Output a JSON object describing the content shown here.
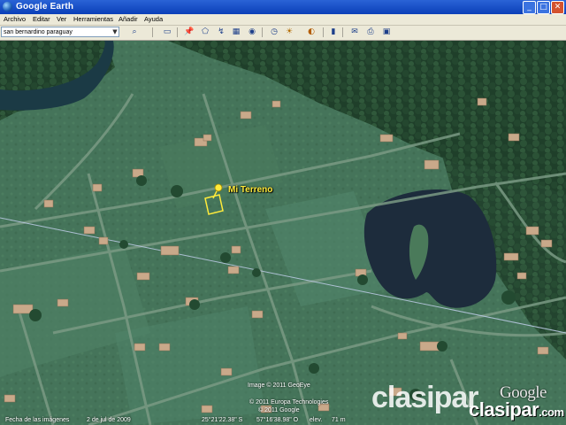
{
  "window": {
    "title": "Google Earth",
    "buttons": [
      "_",
      "□",
      "✕"
    ]
  },
  "menu": [
    "Archivo",
    "Editar",
    "Ver",
    "Herramientas",
    "Añadir",
    "Ayuda"
  ],
  "toolbar": {
    "search_value": "san bernardino paraguay",
    "icons": [
      "search-icon",
      "sidebar-icon",
      "placemark-icon",
      "polygon-icon",
      "path-icon",
      "image-overlay-icon",
      "tour-icon",
      "clock-icon",
      "sun-icon",
      "planets-icon",
      "ruler-icon",
      "email-icon",
      "print-icon",
      "maps-icon"
    ]
  },
  "map": {
    "placemark_label": "Mi Terreno",
    "image_credit": "Image © 2011 GeoEye",
    "copyright_1": "© 2011 Europa Technologies",
    "copyright_2": "© 2011 Google",
    "google_logo": "Google",
    "watermark_1": "clasipar",
    "watermark_2": "clasipar",
    "watermark_2_suffix": ".com",
    "status": {
      "imagery_date_label": "Fecha de las imágenes",
      "imagery_date": "2 de jul de 2009",
      "coordinates": "25°21'22.38\" S",
      "longitude": "57°16'38.98\" O",
      "elevation_label": "elev.",
      "altitude": "71 m"
    }
  }
}
